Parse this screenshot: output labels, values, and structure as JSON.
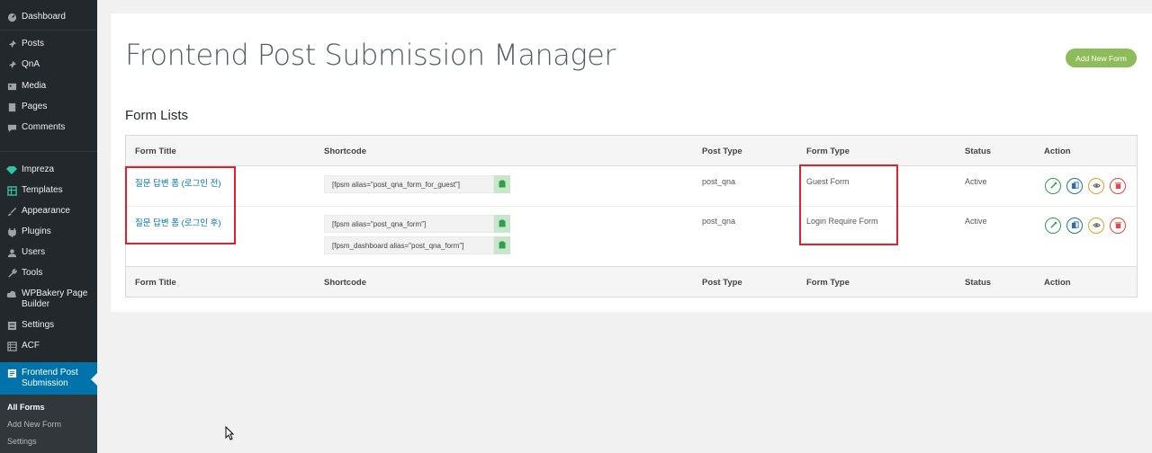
{
  "sidebar": {
    "items": [
      {
        "label": "Dashboard",
        "icon": "dashboard-icon"
      },
      {
        "label": "Posts",
        "icon": "pin-icon"
      },
      {
        "label": "QnA",
        "icon": "pin-icon"
      },
      {
        "label": "Media",
        "icon": "media-icon"
      },
      {
        "label": "Pages",
        "icon": "page-icon"
      },
      {
        "label": "Comments",
        "icon": "comment-icon"
      },
      {
        "label": "Impreza",
        "icon": "diamond-icon"
      },
      {
        "label": "Templates",
        "icon": "table-icon"
      },
      {
        "label": "Appearance",
        "icon": "brush-icon"
      },
      {
        "label": "Plugins",
        "icon": "plug-icon"
      },
      {
        "label": "Users",
        "icon": "user-icon"
      },
      {
        "label": "Tools",
        "icon": "wrench-icon"
      },
      {
        "label": "WPBakery Page Builder",
        "icon": "cloud-icon"
      },
      {
        "label": "Settings",
        "icon": "settings-icon"
      },
      {
        "label": "ACF",
        "icon": "grid-icon"
      },
      {
        "label": "Frontend Post Submission",
        "icon": "form-icon"
      }
    ],
    "submenu": [
      "All Forms",
      "Add New Form",
      "Settings"
    ]
  },
  "page": {
    "title": "Frontend Post Submission Manager",
    "add_button": "Add New Form",
    "section_title": "Form Lists"
  },
  "table": {
    "headers": [
      "Form Title",
      "Shortcode",
      "Post Type",
      "Form Type",
      "Status",
      "Action"
    ],
    "rows": [
      {
        "title": "질문 답변 폼 (로그인 전)",
        "shortcodes": [
          "[fpsm alias=\"post_qna_form_for_guest\"]"
        ],
        "post_type": "post_qna",
        "form_type": "Guest Form",
        "status": "Active"
      },
      {
        "title": "질문 답변 폼 (로그인 후)",
        "shortcodes": [
          "[fpsm alias=\"post_qna_form\"]",
          "[fpsm_dashboard alias=\"post_qna_form\"]"
        ],
        "post_type": "post_qna",
        "form_type": "Login Require Form",
        "status": "Active"
      }
    ],
    "actions": [
      {
        "name": "edit",
        "icon": "pencil-icon",
        "color": "#2e9e4f"
      },
      {
        "name": "copy",
        "icon": "copy-icon",
        "color": "#2a6fa8"
      },
      {
        "name": "preview",
        "icon": "eye-icon",
        "color": "#e0a21b"
      },
      {
        "name": "delete",
        "icon": "trash-icon",
        "color": "#e0484a"
      }
    ]
  },
  "colors": {
    "sidebar_bg": "#23282d",
    "active_menu": "#0073aa",
    "add_button": "#8fbc5a",
    "highlight": "#e0202a"
  }
}
